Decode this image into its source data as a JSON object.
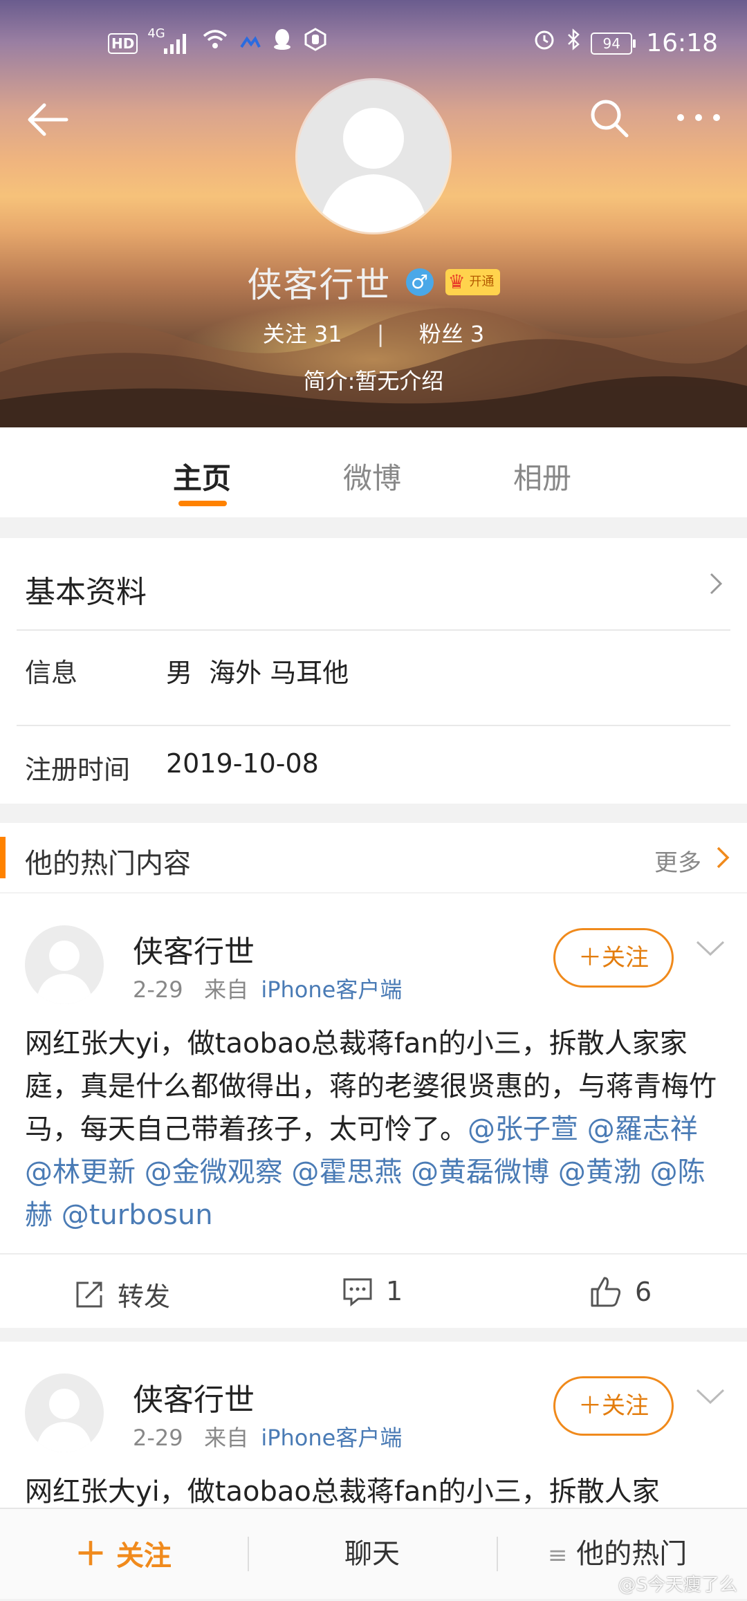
{
  "status_bar": {
    "hd": "HD",
    "network": "4G",
    "battery": "94",
    "time": "16:18"
  },
  "profile": {
    "name": "侠客行世",
    "vip_label": "开通",
    "following_label": "关注",
    "following_count": "31",
    "fans_label": "粉丝",
    "fans_count": "3",
    "bio": "简介:暂无介绍"
  },
  "tabs": [
    {
      "label": "主页",
      "active": true
    },
    {
      "label": "微博",
      "active": false
    },
    {
      "label": "相册",
      "active": false
    }
  ],
  "basic_info": {
    "title": "基本资料",
    "rows": [
      {
        "label": "信息",
        "value": "男  海外 马耳他"
      },
      {
        "label": "注册时间",
        "value": "2019-10-08"
      }
    ]
  },
  "hot_content": {
    "title": "他的热门内容",
    "more": "更多"
  },
  "posts": [
    {
      "author": "侠客行世",
      "date": "2-29",
      "from_label": "来自",
      "source": "iPhone客户端",
      "follow_label": "关注",
      "text": "网红张大yi，做taobao总裁蒋fan的小三，拆散人家家庭，真是什么都做得出，蒋的老婆很贤惠的，与蒋青梅竹马，每天自己带着孩子，太可怜了。",
      "mentions": "@张子萱 @羅志祥 @林更新 @金微观察 @霍思燕 @黄磊微博 @黄渤 @陈赫 @turbosun",
      "repost_label": "转发",
      "comments": "1",
      "likes": "6"
    },
    {
      "author": "侠客行世",
      "date": "2-29",
      "from_label": "来自",
      "source": "iPhone客户端",
      "follow_label": "关注",
      "text": "网红张大yi，做taobao总裁蒋fan的小三，拆散人家"
    }
  ],
  "bottom_bar": {
    "follow": "关注",
    "chat": "聊天",
    "hot": "他的热门"
  },
  "watermark": "@S今天瘦了么",
  "colors": {
    "accent": "#ff8200",
    "link": "#4a7bb5"
  }
}
